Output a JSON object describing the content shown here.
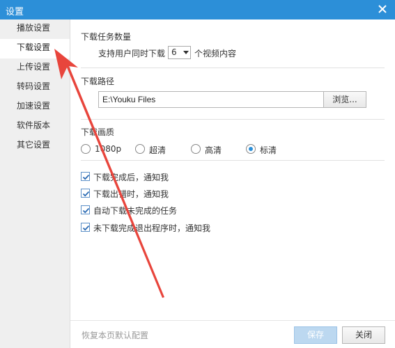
{
  "window": {
    "title": "设置"
  },
  "sidebar": {
    "items": [
      {
        "label": "播放设置",
        "active": false
      },
      {
        "label": "下载设置",
        "active": true
      },
      {
        "label": "上传设置",
        "active": false
      },
      {
        "label": "转码设置",
        "active": false
      },
      {
        "label": "加速设置",
        "active": false
      },
      {
        "label": "软件版本",
        "active": false
      },
      {
        "label": "其它设置",
        "active": false
      }
    ]
  },
  "download": {
    "task_count_title": "下载任务数量",
    "concurrent_prefix": "支持用户同时下载",
    "concurrent_value": "6",
    "concurrent_suffix": "个视频内容",
    "path_title": "下载路径",
    "path_value": "E:\\Youku Files",
    "browse_label": "浏览...",
    "quality_title": "下载画质",
    "quality_options": [
      {
        "label": "1080p",
        "selected": false
      },
      {
        "label": "超清",
        "selected": false
      },
      {
        "label": "高清",
        "selected": false
      },
      {
        "label": "标清",
        "selected": true
      }
    ],
    "checkboxes": [
      {
        "label": "下载完成后，通知我",
        "checked": true
      },
      {
        "label": "下载出错时，通知我",
        "checked": true
      },
      {
        "label": "自动下载未完成的任务",
        "checked": true
      },
      {
        "label": "未下载完成退出程序时，通知我",
        "checked": true
      }
    ]
  },
  "footer": {
    "restore_label": "恢复本页默认配置",
    "save_label": "保存",
    "close_label": "关闭"
  },
  "colors": {
    "titlebar": "#2c8fd8",
    "annotation_arrow": "#e8453c"
  }
}
